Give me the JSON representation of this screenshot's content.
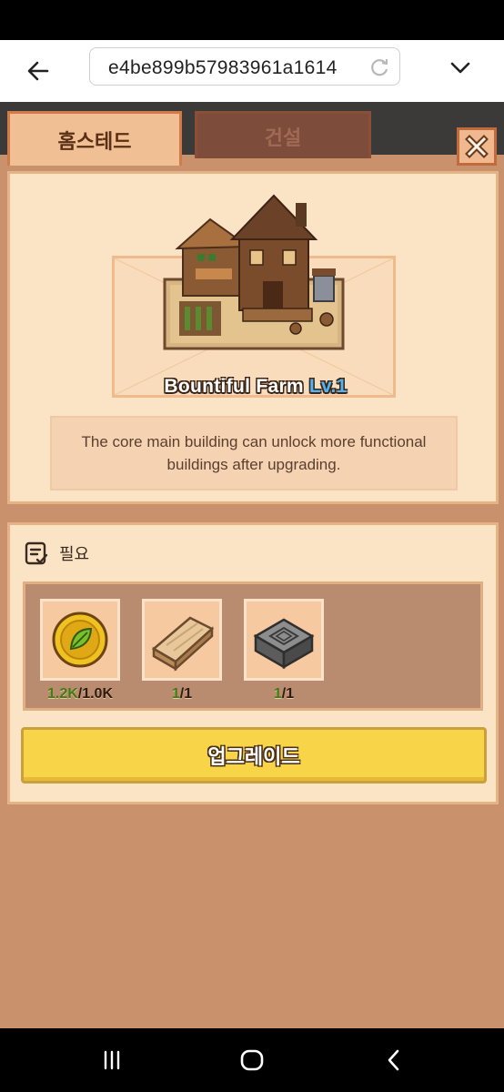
{
  "browser": {
    "url": "e4be899b57983961a1614",
    "icons": {
      "back": "arrow-left-icon",
      "reload": "reload-icon",
      "dropdown": "chevron-down-icon"
    }
  },
  "tabs": [
    {
      "label": "홈스테드",
      "active": true
    },
    {
      "label": "건설",
      "active": false
    }
  ],
  "building": {
    "name": "Bountiful Farm",
    "level": "Lv.1",
    "description": "The core main building can unlock more functional buildings after upgrading."
  },
  "requirements": {
    "title": "필요",
    "items": [
      {
        "icon": "gold-coin-icon",
        "have": "1.2K",
        "need": "/1.0K"
      },
      {
        "icon": "wood-plank-icon",
        "have": "1",
        "need": "/1"
      },
      {
        "icon": "stone-block-icon",
        "have": "1",
        "need": "/1"
      }
    ]
  },
  "upgrade_label": "업그레이드",
  "colors": {
    "accent": "#f8d449",
    "panel": "#fbe4c6",
    "background": "#c9926c",
    "have_green": "#3f7d14"
  }
}
